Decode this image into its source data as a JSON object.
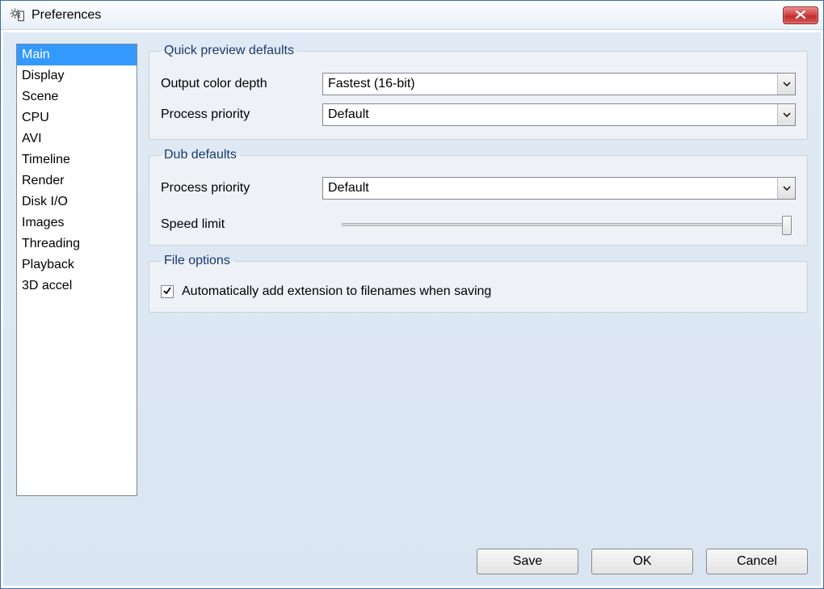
{
  "window": {
    "title": "Preferences"
  },
  "sidebar": {
    "items": [
      {
        "label": "Main",
        "selected": true
      },
      {
        "label": "Display"
      },
      {
        "label": "Scene"
      },
      {
        "label": "CPU"
      },
      {
        "label": "AVI"
      },
      {
        "label": "Timeline"
      },
      {
        "label": "Render"
      },
      {
        "label": "Disk I/O"
      },
      {
        "label": "Images"
      },
      {
        "label": "Threading"
      },
      {
        "label": "Playback"
      },
      {
        "label": "3D accel"
      }
    ]
  },
  "groups": {
    "quick_preview": {
      "legend": "Quick preview defaults",
      "color_depth": {
        "label": "Output color depth",
        "value": "Fastest (16-bit)"
      },
      "priority": {
        "label": "Process priority",
        "value": "Default"
      }
    },
    "dub": {
      "legend": "Dub defaults",
      "priority": {
        "label": "Process priority",
        "value": "Default"
      },
      "speed": {
        "label": "Speed limit"
      }
    },
    "file": {
      "legend": "File options",
      "auto_ext": {
        "label": "Automatically add extension to filenames when saving",
        "checked": true
      }
    }
  },
  "buttons": {
    "save": "Save",
    "ok": "OK",
    "cancel": "Cancel"
  }
}
